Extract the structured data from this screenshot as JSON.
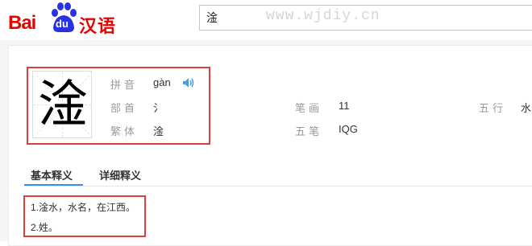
{
  "header": {
    "logo_left": "Bai",
    "logo_du": "du",
    "logo_right": "汉语",
    "search_value": "淦",
    "watermark": "www.wjdiy.cn"
  },
  "entry": {
    "character": "淦",
    "pinyin_label": "拼音",
    "pinyin": "gàn",
    "radical_label": "部首",
    "radical": "氵",
    "traditional_label": "繁体",
    "traditional": "淦",
    "strokes_label": "笔画",
    "strokes": "11",
    "wubi_label": "五笔",
    "wubi": "IQG",
    "wuxing_label": "五行",
    "wuxing": "水"
  },
  "tabs": [
    {
      "label": "基本释义",
      "active": true
    },
    {
      "label": "详细释义",
      "active": false
    }
  ],
  "definitions": [
    "1.淦水，水名，在江西。",
    "2.姓。"
  ],
  "colors": {
    "brand_red": "#e10601",
    "paw_blue": "#2932e1",
    "highlight_red": "#d9403a",
    "tab_blue": "#3b8ee8"
  }
}
